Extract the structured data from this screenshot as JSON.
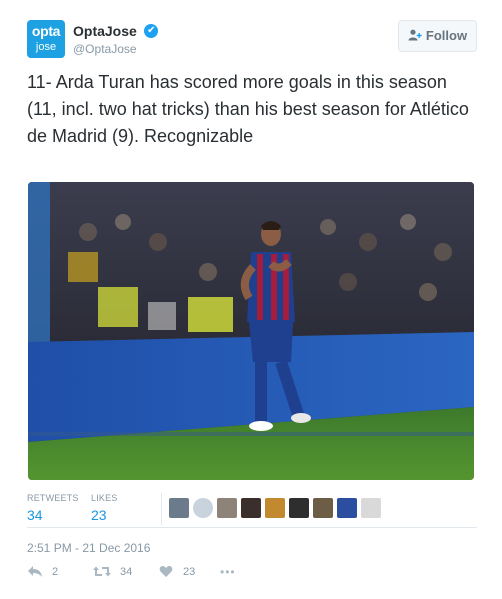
{
  "author": {
    "display_name": "OptaJose",
    "handle": "@OptaJose",
    "avatar_line1": "opta",
    "avatar_line2": "jose",
    "verified_icon": "✔"
  },
  "follow_button": {
    "label": "Follow",
    "icon": "person-plus-icon"
  },
  "tweet": {
    "text": "11- Arda Turan has scored more goals in this season (11, incl. two hat tricks) than his best season for Atlético de Madrid (9). Recognizable"
  },
  "stats": {
    "retweets_label": "RETWEETS",
    "retweets_value": "34",
    "likes_label": "LIKES",
    "likes_value": "23"
  },
  "timestamp": "2:51 PM - 21 Dec 2016",
  "actions": {
    "reply_count": "2",
    "retweet_count": "34",
    "like_count": "23",
    "more_label": "•••"
  },
  "colors": {
    "accent": "#1b95e0",
    "avatar_bg": "#1da1e2",
    "muted": "#8899a6",
    "divider": "#e1e8ed"
  }
}
